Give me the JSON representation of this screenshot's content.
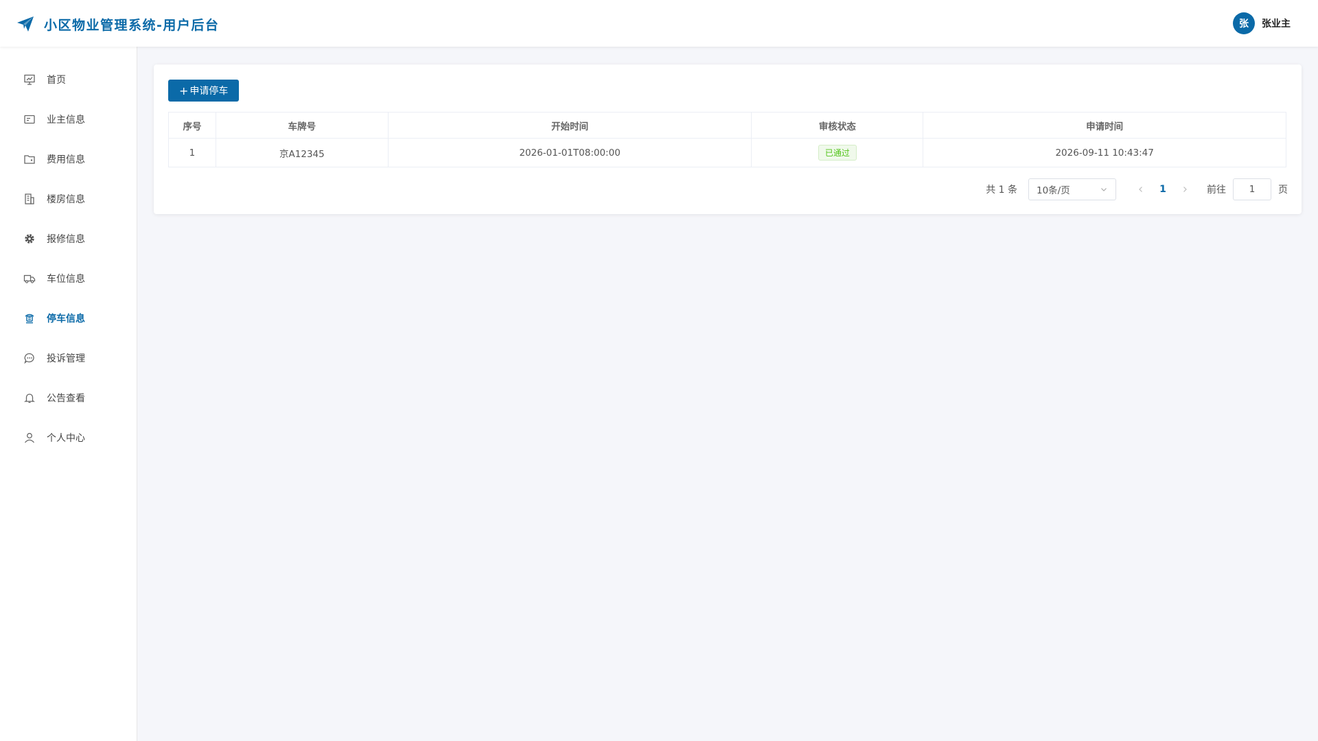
{
  "header": {
    "title": "小区物业管理系统-用户后台",
    "avatar_char": "张",
    "user_name": "张业主",
    "accent_color": "#0b6aa8"
  },
  "sidebar": {
    "items": [
      {
        "label": "首页",
        "icon": "presentation-icon"
      },
      {
        "label": "业主信息",
        "icon": "id-card-icon"
      },
      {
        "label": "费用信息",
        "icon": "folder-icon"
      },
      {
        "label": "楼房信息",
        "icon": "building-icon"
      },
      {
        "label": "报修信息",
        "icon": "gear-icon"
      },
      {
        "label": "车位信息",
        "icon": "truck-icon"
      },
      {
        "label": "停车信息",
        "icon": "parking-icon",
        "active": true
      },
      {
        "label": "投诉管理",
        "icon": "chat-bubble-icon"
      },
      {
        "label": "公告查看",
        "icon": "bell-icon"
      },
      {
        "label": "个人中心",
        "icon": "user-icon"
      }
    ]
  },
  "toolbar": {
    "add_label": "申请停车"
  },
  "table": {
    "columns": [
      "序号",
      "车牌号",
      "开始时间",
      "审核状态",
      "申请时间"
    ],
    "rows": [
      {
        "index": "1",
        "plate": "京A12345",
        "start_time": "2026-01-01T08:00:00",
        "status": "已通过",
        "apply_time": "2026-09-11 10:43:47"
      }
    ]
  },
  "pagination": {
    "total_text": "共 1 条",
    "page_size": "10条/页",
    "current_page": "1",
    "goto_label": "前往",
    "goto_value": "1",
    "page_unit": "页"
  }
}
